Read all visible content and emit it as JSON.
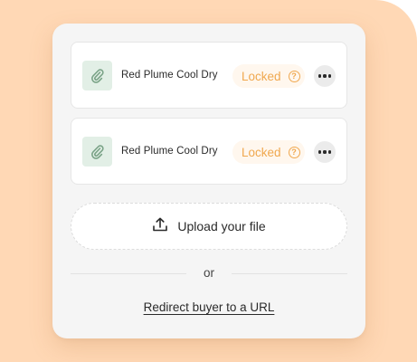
{
  "files": [
    {
      "name": "Red Plume Cool Dry",
      "status": "Locked"
    },
    {
      "name": "Red Plume Cool Dry",
      "status": "Locked"
    }
  ],
  "upload": {
    "label": "Upload your file",
    "icon": "upload-icon"
  },
  "divider": {
    "text": "or"
  },
  "redirect": {
    "label": "Redirect buyer to a URL"
  },
  "colors": {
    "background": "#ffd8b5",
    "card": "#f5f5f5",
    "accent_locked": "#f0a84f",
    "clip_bg": "#e2efe6",
    "clip_icon": "#7aa387"
  }
}
